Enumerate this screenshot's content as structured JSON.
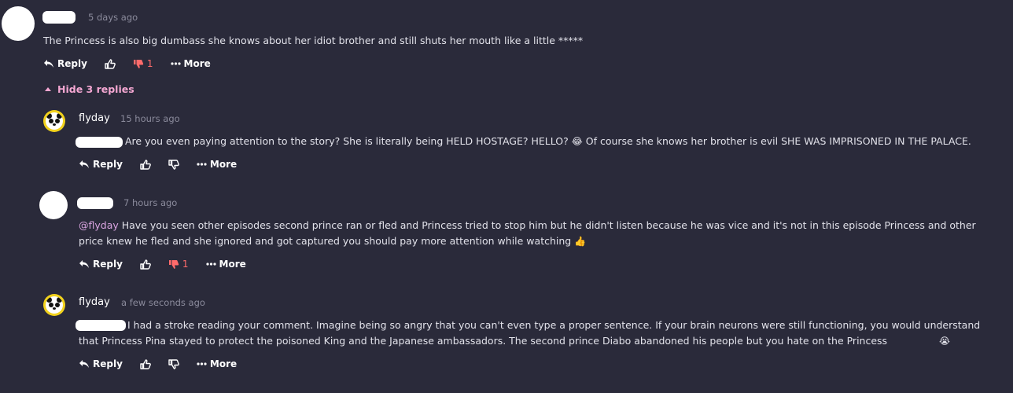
{
  "comments": [
    {
      "time": "5 days ago",
      "text": "The Princess is also big dumbass she knows about her idiot brother and still shuts her mouth like a little *****",
      "reply_label": "Reply",
      "dislike_count": "1",
      "more_label": "More"
    }
  ],
  "hide_replies_label": "Hide 3 replies",
  "replies": [
    {
      "username": "flyday",
      "time": "15 hours ago",
      "text": "Are you even paying attention to the story? She is literally being HELD HOSTAGE? HELLO?",
      "emoji": "😂",
      "text_after": "Of course she knows her brother is evil SHE WAS IMPRISONED IN THE PALACE.",
      "reply_label": "Reply",
      "more_label": "More"
    },
    {
      "time": "7 hours ago",
      "mention": "@flyday",
      "text": "Have you seen other episodes second prince ran or fled and Princess tried to stop him but he didn't listen because he was vice and it's not in this episode Princess and other price knew he fled and she ignored and got captured you should pay more attention while watching",
      "emoji": "👍",
      "reply_label": "Reply",
      "dislike_count": "1",
      "more_label": "More"
    },
    {
      "username": "flyday",
      "time": "a few seconds ago",
      "text": "I had a stroke reading your comment. Imagine being so angry that you can't even type a proper sentence. If your brain neurons were still functioning, you would understand that Princess Pina stayed to protect the poisoned King and the Japanese ambassadors. The second prince Diabo abandoned his people but you hate on the Princess",
      "emoji": "😭",
      "reply_label": "Reply",
      "more_label": "More"
    }
  ],
  "colors": {
    "background": "#2a2a3a",
    "accent_pink": "#f4a7d2",
    "dislike_red": "#ff6b6b",
    "mention": "#d9a4e0",
    "muted": "#8b8b9c"
  },
  "icons": [
    "reply-icon",
    "thumbs-up-icon",
    "thumbs-down-icon",
    "more-dots-icon",
    "caret-up-icon",
    "panda-avatar-icon"
  ]
}
